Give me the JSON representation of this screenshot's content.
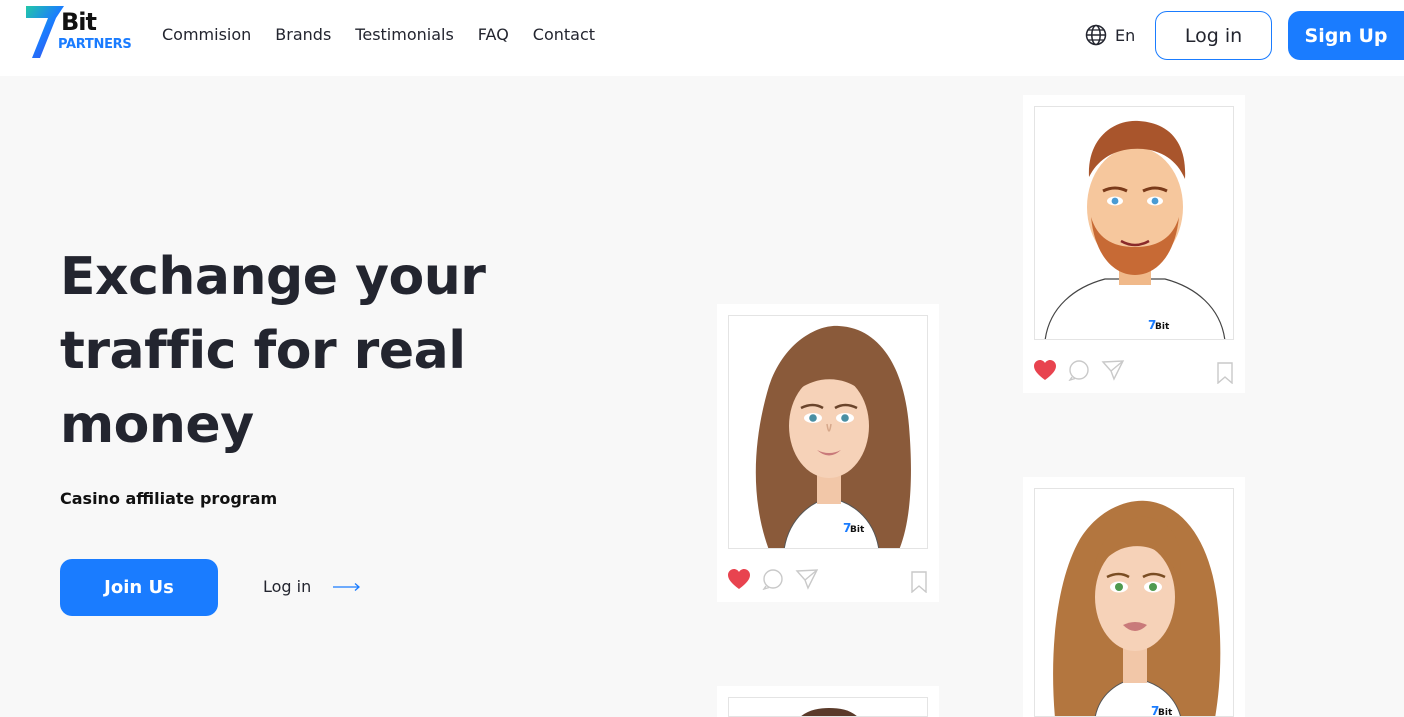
{
  "brand": {
    "logo_seven": "7",
    "logo_bit": "Bit",
    "logo_partners": "PARTNERS",
    "accent": "#1a7cff"
  },
  "nav": {
    "items": [
      "Commision",
      "Brands",
      "Testimonials",
      "FAQ",
      "Contact"
    ]
  },
  "header": {
    "language": "En",
    "login_label": "Log in",
    "signup_label": "Sign Up"
  },
  "hero": {
    "title": "Exchange your traffic for real money",
    "subtitle": "Casino affiliate program",
    "join_label": "Join Us",
    "login_label": "Log in"
  },
  "cards": [
    {
      "name": "woman-brown-hair",
      "liked": true
    },
    {
      "name": "man-beard",
      "liked": true
    },
    {
      "name": "woman-long-hair",
      "liked": false
    },
    {
      "name": "partial-card",
      "liked": false
    }
  ],
  "colors": {
    "like": "#e8434f",
    "text": "#23252f",
    "background": "#f8f8f8"
  }
}
